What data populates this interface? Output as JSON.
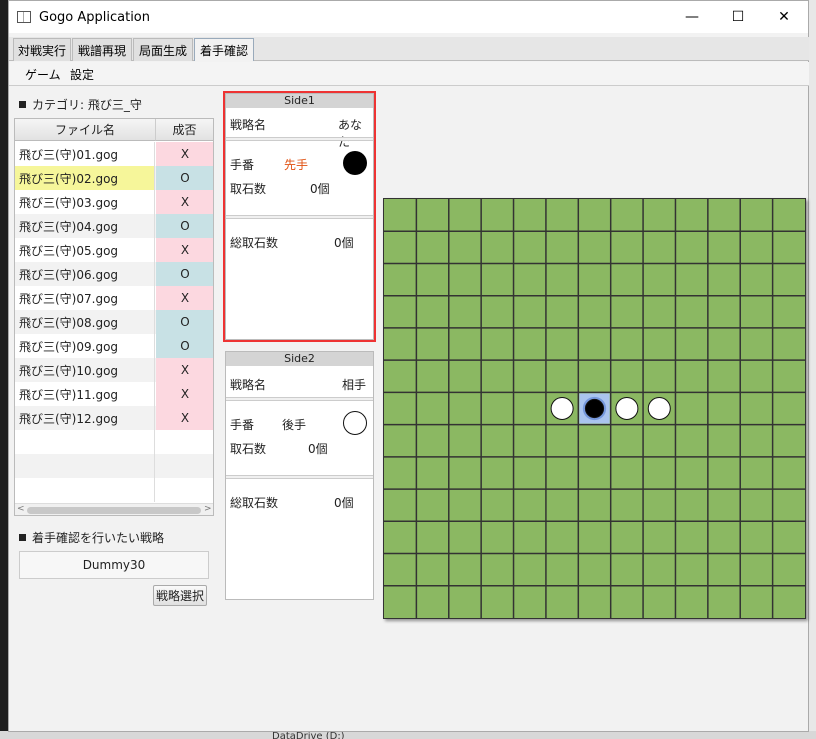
{
  "window": {
    "title": "Gogo Application",
    "controls": {
      "minimize": "—",
      "maximize": "☐",
      "close": "✕"
    }
  },
  "tabs": [
    "対戦実行",
    "戦譜再現",
    "局面生成",
    "着手確認"
  ],
  "active_tab": "着手確認",
  "menus": [
    "ゲーム",
    "設定"
  ],
  "category": {
    "label": "カテゴリ: 飛び三_守"
  },
  "file_table": {
    "columns": [
      "ファイル名",
      "成否"
    ],
    "rows": [
      {
        "name": "飛び三(守)01.gog",
        "result": "X"
      },
      {
        "name": "飛び三(守)02.gog",
        "result": "O"
      },
      {
        "name": "飛び三(守)03.gog",
        "result": "X"
      },
      {
        "name": "飛び三(守)04.gog",
        "result": "O"
      },
      {
        "name": "飛び三(守)05.gog",
        "result": "X"
      },
      {
        "name": "飛び三(守)06.gog",
        "result": "O"
      },
      {
        "name": "飛び三(守)07.gog",
        "result": "X"
      },
      {
        "name": "飛び三(守)08.gog",
        "result": "O"
      },
      {
        "name": "飛び三(守)09.gog",
        "result": "O"
      },
      {
        "name": "飛び三(守)10.gog",
        "result": "X"
      },
      {
        "name": "飛び三(守)11.gog",
        "result": "X"
      },
      {
        "name": "飛び三(守)12.gog",
        "result": "X"
      }
    ],
    "selected_index": 1
  },
  "strategy": {
    "label": "着手確認を行いたい戦略",
    "value": "Dummy30",
    "button_label": "戦略選択"
  },
  "side1": {
    "header": "Side1",
    "strategy_label": "戦略名",
    "strategy_value": "あなた",
    "turn_label": "手番",
    "turn_value": "先手",
    "stone_color": "black",
    "captured_label": "取石数",
    "captured_value": "0個",
    "total_label": "総取石数",
    "total_value": "0個"
  },
  "side2": {
    "header": "Side2",
    "strategy_label": "戦略名",
    "strategy_value": "相手",
    "turn_label": "手番",
    "turn_value": "後手",
    "stone_color": "white",
    "captured_label": "取石数",
    "captured_value": "0個",
    "total_label": "総取石数",
    "total_value": "0個"
  },
  "board": {
    "size": 13,
    "stones": [
      {
        "row": 6,
        "col": 5,
        "color": "white"
      },
      {
        "row": 6,
        "col": 6,
        "color": "black",
        "highlight": true
      },
      {
        "row": 6,
        "col": 7,
        "color": "white"
      },
      {
        "row": 6,
        "col": 8,
        "color": "white"
      }
    ]
  },
  "background": {
    "bottom_label": "DataDrive (D:)"
  },
  "colors": {
    "board_green": "#8bb862",
    "result_x_bg": "#fcd8e0",
    "result_o_bg": "#c8e1e5",
    "selected_row_bg": "#f6f69a",
    "first_player_text": "#e05010",
    "highlight_outline": "#e33333",
    "last_move_bg": "#7799dd"
  }
}
